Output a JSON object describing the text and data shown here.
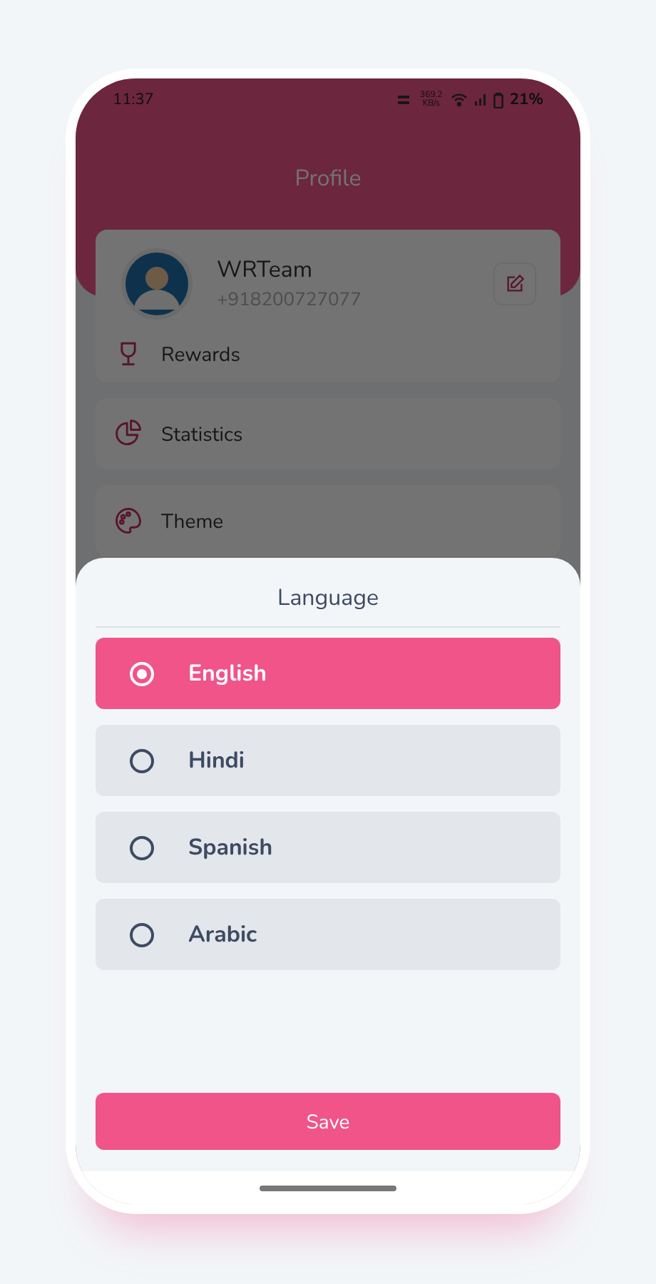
{
  "status_bar": {
    "time": "11:37",
    "speed": "369.2 KB/s",
    "battery": "21%"
  },
  "header": {
    "title": "Profile"
  },
  "profile": {
    "name": "WRTeam",
    "phone": "+918200727077"
  },
  "menu": [
    {
      "kind": "rewards",
      "label": "Rewards"
    },
    {
      "kind": "statistics",
      "label": "Statistics"
    },
    {
      "kind": "theme",
      "label": "Theme"
    }
  ],
  "language_sheet": {
    "title": "Language",
    "options": [
      {
        "label": "English",
        "selected": true
      },
      {
        "label": "Hindi",
        "selected": false
      },
      {
        "label": "Spanish",
        "selected": false
      },
      {
        "label": "Arabic",
        "selected": false
      }
    ],
    "save_button": "Save"
  }
}
